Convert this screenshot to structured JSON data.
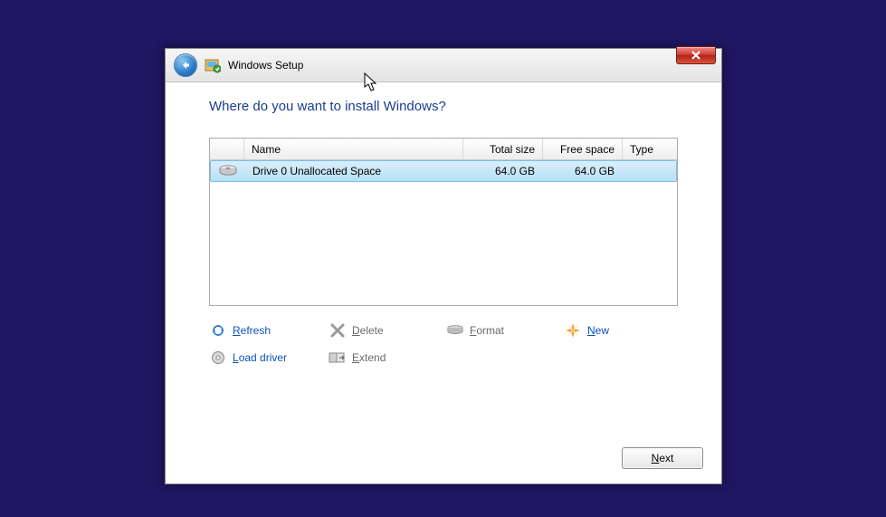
{
  "window": {
    "title": "Windows Setup"
  },
  "heading": "Where do you want to install Windows?",
  "columns": {
    "name": "Name",
    "total": "Total size",
    "free": "Free space",
    "type": "Type"
  },
  "drives": [
    {
      "name": "Drive 0 Unallocated Space",
      "total": "64.0 GB",
      "free": "64.0 GB",
      "type": ""
    }
  ],
  "actions": {
    "refresh": "Refresh",
    "delete": "Delete",
    "format": "Format",
    "new": "New",
    "load_driver": "Load driver",
    "extend": "Extend"
  },
  "buttons": {
    "next": "Next"
  }
}
